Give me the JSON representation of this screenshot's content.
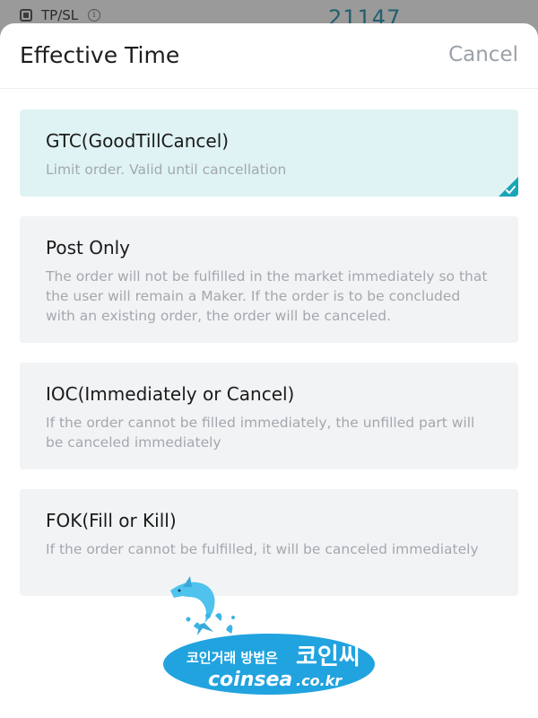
{
  "background": {
    "checkbox_label": "TP/SL",
    "info_icon": "i",
    "number": "21147"
  },
  "sheet": {
    "title": "Effective Time",
    "cancel_label": "Cancel"
  },
  "options": [
    {
      "title": "GTC(GoodTillCancel)",
      "description": "Limit order. Valid until cancellation",
      "selected": true
    },
    {
      "title": "Post Only",
      "description": "The order will not be fulfilled in the market immediately so that the user will remain a Maker. If the order is to be concluded with an existing order, the order will be canceled.",
      "selected": false
    },
    {
      "title": "IOC(Immediately or Cancel)",
      "description": "If the order cannot be filled immediately, the unfilled part will be canceled immediately",
      "selected": false
    },
    {
      "title": "FOK(Fill or Kill)",
      "description": "If the order cannot be fulfilled, it will be canceled immediately",
      "selected": false
    }
  ],
  "watermark": {
    "line1": "코인거래 방법은",
    "brand_kr": "코인씨",
    "brand_en": "coinsea",
    "domain": ".co.kr"
  },
  "colors": {
    "accent": "#1aa6b7",
    "selected_bg": "#dff3f4",
    "option_bg": "#f2f3f5"
  }
}
